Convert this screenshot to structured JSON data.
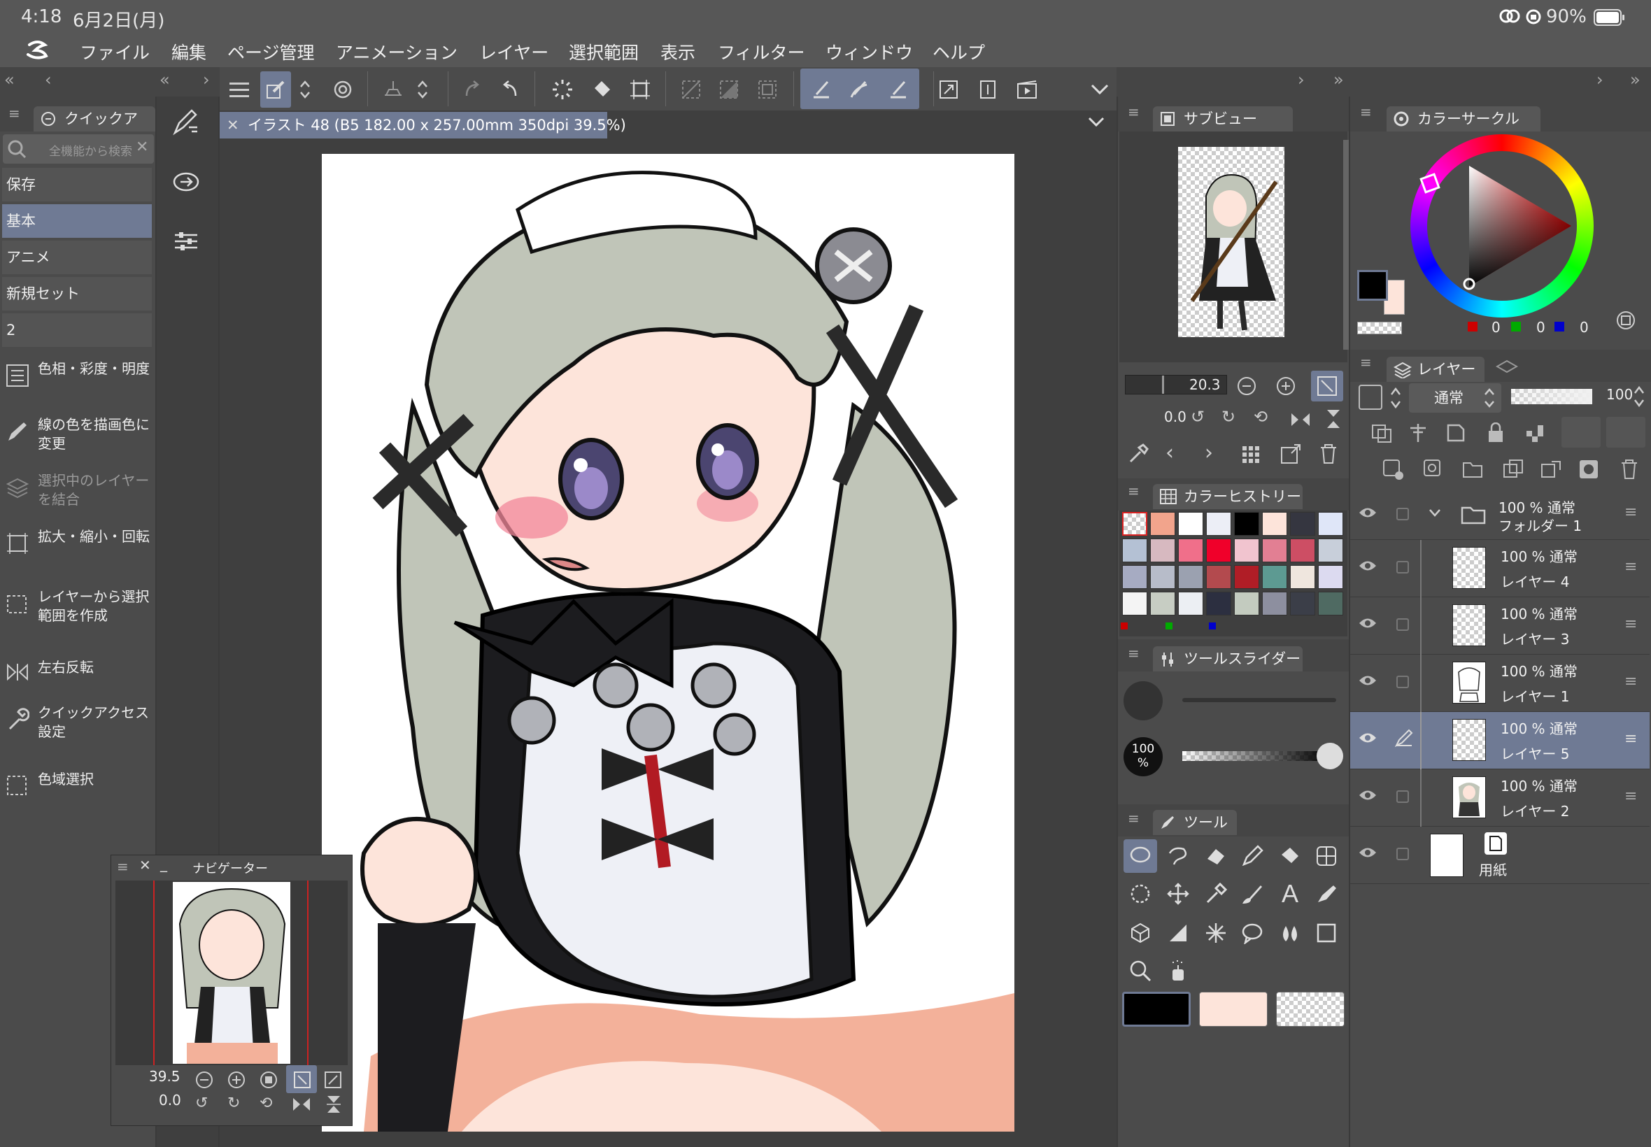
{
  "status": {
    "time": "4:18",
    "date": "6月2日(月)",
    "battery": "90%"
  },
  "menu": [
    "ファイル",
    "編集",
    "ページ管理",
    "アニメーション",
    "レイヤー",
    "選択範囲",
    "表示",
    "フィルター",
    "ウィンドウ",
    "ヘルプ"
  ],
  "document_tab": {
    "title": "イラスト 48 (B5 182.00 x 257.00mm 350dpi 39.5%)"
  },
  "quick_access": {
    "tab": "クイックア",
    "search_placeholder": "全機能から検索",
    "sets": [
      {
        "label": "保存",
        "selected": false
      },
      {
        "label": "基本",
        "selected": true
      },
      {
        "label": "アニメ",
        "selected": false
      },
      {
        "label": "新規セット",
        "selected": false
      },
      {
        "label": "2",
        "selected": false
      }
    ],
    "commands": [
      {
        "label": "色相・彩度・明度",
        "icon": "hue-saturation-icon",
        "enabled": true
      },
      {
        "label": "線の色を描画色に変更",
        "icon": "pen-color-icon",
        "enabled": true
      },
      {
        "label": "選択中のレイヤーを結合",
        "icon": "merge-layers-icon",
        "enabled": false
      },
      {
        "label": "拡大・縮小・回転",
        "icon": "scale-rotate-icon",
        "enabled": true
      },
      {
        "label": "レイヤーから選択範囲を作成",
        "icon": "selection-from-layer-icon",
        "enabled": true
      },
      {
        "label": "左右反転",
        "icon": "flip-horizontal-icon",
        "enabled": true
      },
      {
        "label": "クイックアクセス設定",
        "icon": "wrench-icon",
        "enabled": true
      },
      {
        "label": "色域選択",
        "icon": "color-range-icon",
        "enabled": true
      }
    ]
  },
  "navigator": {
    "title": "ナビゲーター",
    "zoom": "39.5",
    "angle": "0.0"
  },
  "subview": {
    "title": "サブビュー",
    "zoom": "20.3",
    "angle": "0.0"
  },
  "color_history": {
    "title": "カラーヒストリー",
    "colors": [
      "#f2a48c",
      "#ffffff",
      "#eceef6",
      "#000000",
      "#fde4da",
      "#353640",
      "#dfe6f8",
      "#b4c1d4",
      "#d7b9c0",
      "#f06f8a",
      "#f0002a",
      "#f1c4cf",
      "#e27f93",
      "#cd4e64",
      "#c8cfda",
      "#a6abc2",
      "#b7bcc9",
      "#9ba1b0",
      "#b34a4e",
      "#b01d26",
      "#5d9a92",
      "#efe6de",
      "#dcdaf0",
      "#f4f4f4",
      "#c7cdc3",
      "#eceff3",
      "#2c2f40",
      "#c3cbbf",
      "#8d8f9f",
      "#3b3e48",
      "#4f6a62"
    ]
  },
  "tool_slider": {
    "title": "ツールスライダー",
    "opacity": "100",
    "opacity_unit": "%"
  },
  "tools": {
    "title": "ツール"
  },
  "color_circle": {
    "title": "カラーサークル",
    "r": "0",
    "g": "0",
    "b": "0"
  },
  "layers": {
    "title": "レイヤー",
    "blend_mode": "通常",
    "opacity": "100",
    "items": [
      {
        "percent": "100 %",
        "mode": "通常",
        "name": "フォルダー 1",
        "type": "folder"
      },
      {
        "percent": "100 %",
        "mode": "通常",
        "name": "レイヤー 4",
        "type": "layer"
      },
      {
        "percent": "100 %",
        "mode": "通常",
        "name": "レイヤー 3",
        "type": "layer"
      },
      {
        "percent": "100 %",
        "mode": "通常",
        "name": "レイヤー 1",
        "type": "layer"
      },
      {
        "percent": "100 %",
        "mode": "通常",
        "name": "レイヤー 5",
        "type": "layer",
        "selected": true
      },
      {
        "percent": "100 %",
        "mode": "通常",
        "name": "レイヤー 2",
        "type": "layer"
      },
      {
        "name": "用紙",
        "type": "paper"
      }
    ]
  },
  "colors": {
    "accent": "#6f7a94",
    "panel": "#4b4b4b",
    "bg": "#3a3a3a",
    "main_color": "#000000",
    "sub_color": "#fde4da"
  }
}
